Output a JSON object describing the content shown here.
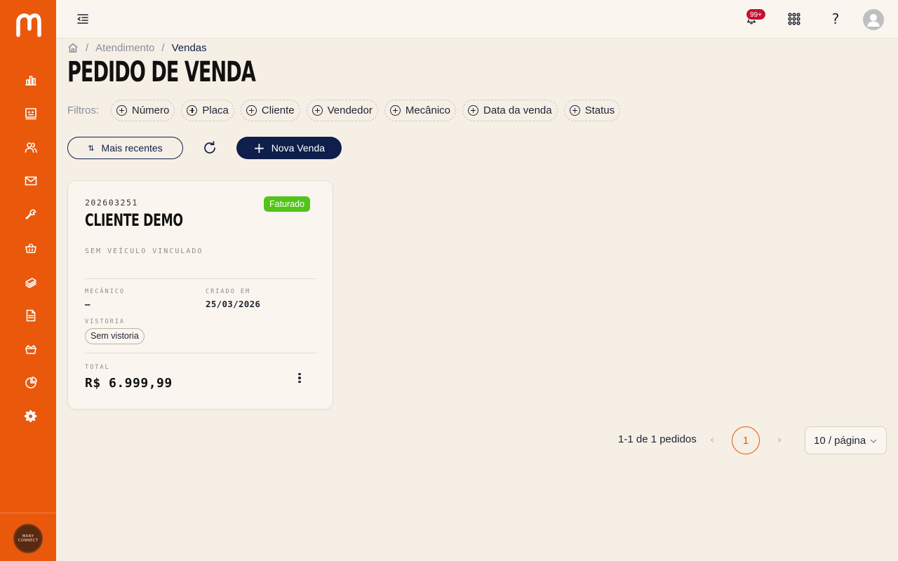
{
  "theme": {
    "brand": "#ea580c",
    "navy": "#0f1f4b",
    "success": "#52c41a",
    "notification": "#c8102e"
  },
  "sidebar": {
    "org_avatar_line1": "MANY",
    "org_avatar_line2": "CONNECT",
    "items": [
      {
        "icon": "bar-chart-icon"
      },
      {
        "icon": "dashboard-face-icon"
      },
      {
        "icon": "users-icon"
      },
      {
        "icon": "mail-icon"
      },
      {
        "icon": "wrench-icon"
      },
      {
        "icon": "basket-icon"
      },
      {
        "icon": "money-stack-icon"
      },
      {
        "icon": "document-icon"
      },
      {
        "icon": "crown-basket-icon"
      },
      {
        "icon": "pie-chart-icon"
      },
      {
        "icon": "gear-icon"
      }
    ]
  },
  "topbar": {
    "notification_count": "99+",
    "help_label": "?"
  },
  "breadcrumb": {
    "parent": "Atendimento",
    "current": "Vendas",
    "separator": "/"
  },
  "page": {
    "title": "PEDIDO DE VENDA"
  },
  "filters": {
    "label": "Filtros:",
    "chips": [
      "Número",
      "Placa",
      "Cliente",
      "Vendedor",
      "Mecânico",
      "Data da venda",
      "Status"
    ]
  },
  "actions": {
    "sort_label": "Mais recentes",
    "new_label": "Nova Venda"
  },
  "orders": [
    {
      "number": "202603251",
      "client": "CLIENTE DEMO",
      "status": "Faturado",
      "vehicle": "SEM VEÍCULO VINCULADO",
      "mechanic_label": "MECÂNICO",
      "mechanic_value": "—",
      "created_label": "CRIADO EM",
      "created_value": "25/03/2026",
      "inspection_label": "VISTORIA",
      "inspection_value": "Sem vistoria",
      "total_label": "TOTAL",
      "total_value": "R$ 6.999,99"
    }
  ],
  "pagination": {
    "summary": "1-1 de 1 pedidos",
    "current_page": "1",
    "page_size": "10 / página",
    "prev": "‹",
    "next": "›"
  }
}
